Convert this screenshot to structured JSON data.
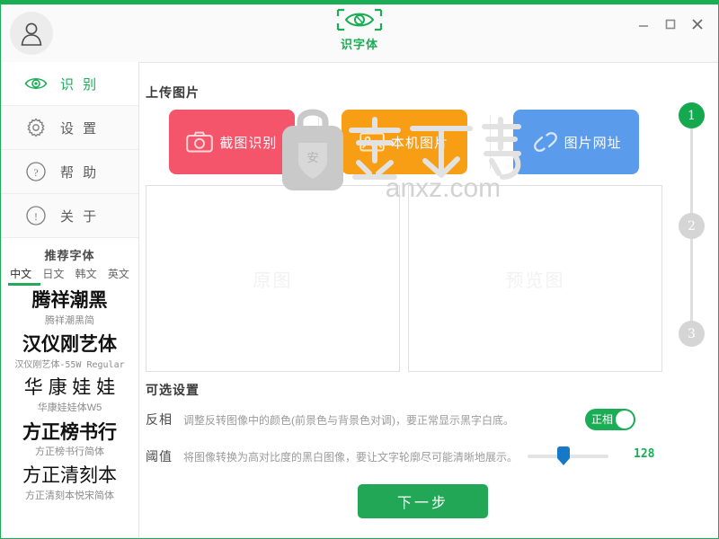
{
  "window": {
    "accent_green": "#1aad55",
    "app_name": "识字体",
    "controls": {
      "minimize": "—",
      "maximize": "□",
      "close": "✕"
    }
  },
  "sidebar": {
    "nav": [
      {
        "label": "识 别",
        "icon": "eye-icon",
        "active": true
      },
      {
        "label": "设 置",
        "icon": "gear-icon",
        "active": false
      },
      {
        "label": "帮 助",
        "icon": "question-circle-icon",
        "active": false
      },
      {
        "label": "关 于",
        "icon": "exclamation-circle-icon",
        "active": false
      }
    ],
    "fonts_header": "推荐字体",
    "font_tabs": [
      {
        "label": "中文",
        "active": true
      },
      {
        "label": "日文",
        "active": false
      },
      {
        "label": "韩文",
        "active": false
      },
      {
        "label": "英文",
        "active": false
      }
    ],
    "fonts": [
      {
        "sample": "腾祥潮黑",
        "name": "腾祥潮黑简"
      },
      {
        "sample": "汉仪刚艺体",
        "name": "汉仪刚艺体-55W Regular"
      },
      {
        "sample": "华 康 娃 娃",
        "name": "华康娃娃体W5"
      },
      {
        "sample": "方正榜书行",
        "name": "方正榜书行简体"
      },
      {
        "sample": "方正清刻本",
        "name": "方正清刻本悦宋简体"
      }
    ]
  },
  "main": {
    "upload_title": "上传图片",
    "upload_buttons": [
      {
        "label": "截图识别",
        "icon": "camera-icon",
        "color": "#f5556b"
      },
      {
        "label": "本机图片",
        "icon": "picture-icon",
        "color": "#f79e15"
      },
      {
        "label": "图片网址",
        "icon": "link-icon",
        "color": "#5a9bec"
      }
    ],
    "panels": [
      {
        "label": "原图"
      },
      {
        "label": "预览图"
      }
    ],
    "watermark": "anxz.com",
    "options_title": "可选设置",
    "options": [
      {
        "label": "反相",
        "desc": "调整反转图像中的颜色(前景色与背景色对调)，要正常显示黑字白底。",
        "toggle_label": "正相",
        "toggle_on": true
      },
      {
        "label": "阈值",
        "desc": "将图像转换为高对比度的黑白图像，要让文字轮廓尽可能清晰地展示。",
        "value": "128",
        "percent": 40
      }
    ],
    "next_button": "下一步",
    "steps": [
      {
        "label": "1",
        "active": true
      },
      {
        "label": "2",
        "active": false
      },
      {
        "label": "3",
        "active": false
      }
    ]
  }
}
